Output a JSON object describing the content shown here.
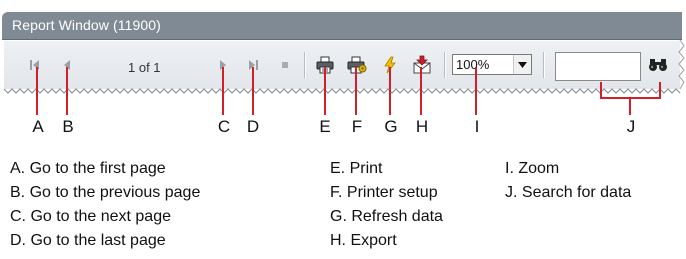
{
  "window": {
    "title": "Report Window (11900)",
    "page_info": "1 of 1",
    "zoom": {
      "selected": "100%"
    },
    "search": {
      "value": ""
    }
  },
  "toolbar_icons": [
    "first-page-icon",
    "previous-page-icon",
    "next-page-icon",
    "last-page-icon",
    "stop-icon",
    "print-icon",
    "printer-setup-icon",
    "refresh-icon",
    "export-icon",
    "dropdown-arrow-icon",
    "binoculars-icon"
  ],
  "colors": {
    "title_bar": "#7f8a94",
    "toolbar": "#e6e9ec",
    "callout": "#d0202a",
    "refresh_bolt": "#f2c200",
    "export_red": "#c8202a"
  },
  "markers": [
    "A",
    "B",
    "C",
    "D",
    "E",
    "F",
    "G",
    "H",
    "I",
    "J"
  ],
  "legend": {
    "col1": [
      "A. Go to the first page",
      "B. Go to the previous page",
      "C. Go to the next page",
      "D. Go to the last page"
    ],
    "col2": [
      "E. Print",
      "F. Printer setup",
      "G. Refresh data",
      "H. Export"
    ],
    "col3": [
      "I. Zoom",
      "J. Search for data"
    ]
  }
}
